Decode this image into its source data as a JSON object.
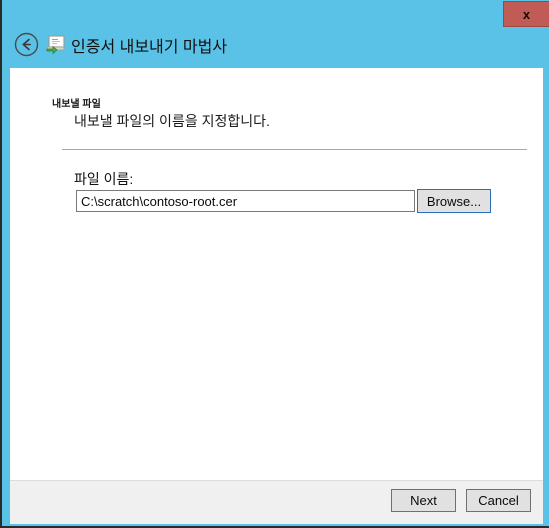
{
  "window": {
    "title": "인증서 내보내기 마법사",
    "title_bar_color": "#5BC2E7",
    "close_button_label": "x",
    "close_button_color": "#C15B55",
    "back_button_name": "back-arrow",
    "wizard_icon_name": "certificate-export-icon"
  },
  "header": {
    "heading": "내보낼 파일",
    "subtitle": "내보낼 파일의 이름을 지정합니다."
  },
  "form": {
    "filename_label": "파일 이름:",
    "filename_value": "C:\\scratch\\contoso-root.cer",
    "filename_placeholder": "",
    "browse_label": "Browse..."
  },
  "footer": {
    "next_label": "Next",
    "cancel_label": "Cancel"
  }
}
